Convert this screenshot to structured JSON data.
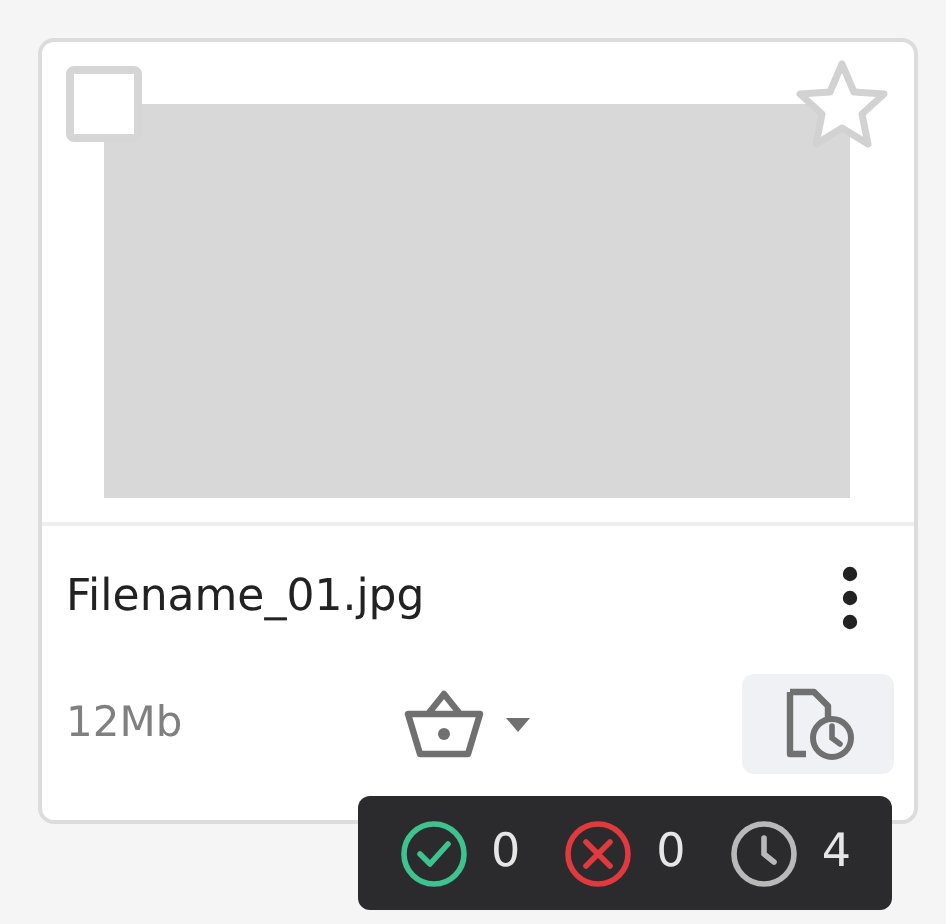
{
  "card": {
    "checked": false,
    "starred": false,
    "filename": "Filename_01.jpg",
    "size": "12Mb"
  },
  "status_tooltip": {
    "items": [
      {
        "kind": "approved",
        "color": "#3ec28f",
        "count": "0"
      },
      {
        "kind": "rejected",
        "color": "#e0393e",
        "count": "0"
      },
      {
        "kind": "pending",
        "color": "#b9b9b9",
        "count": "4"
      }
    ]
  }
}
